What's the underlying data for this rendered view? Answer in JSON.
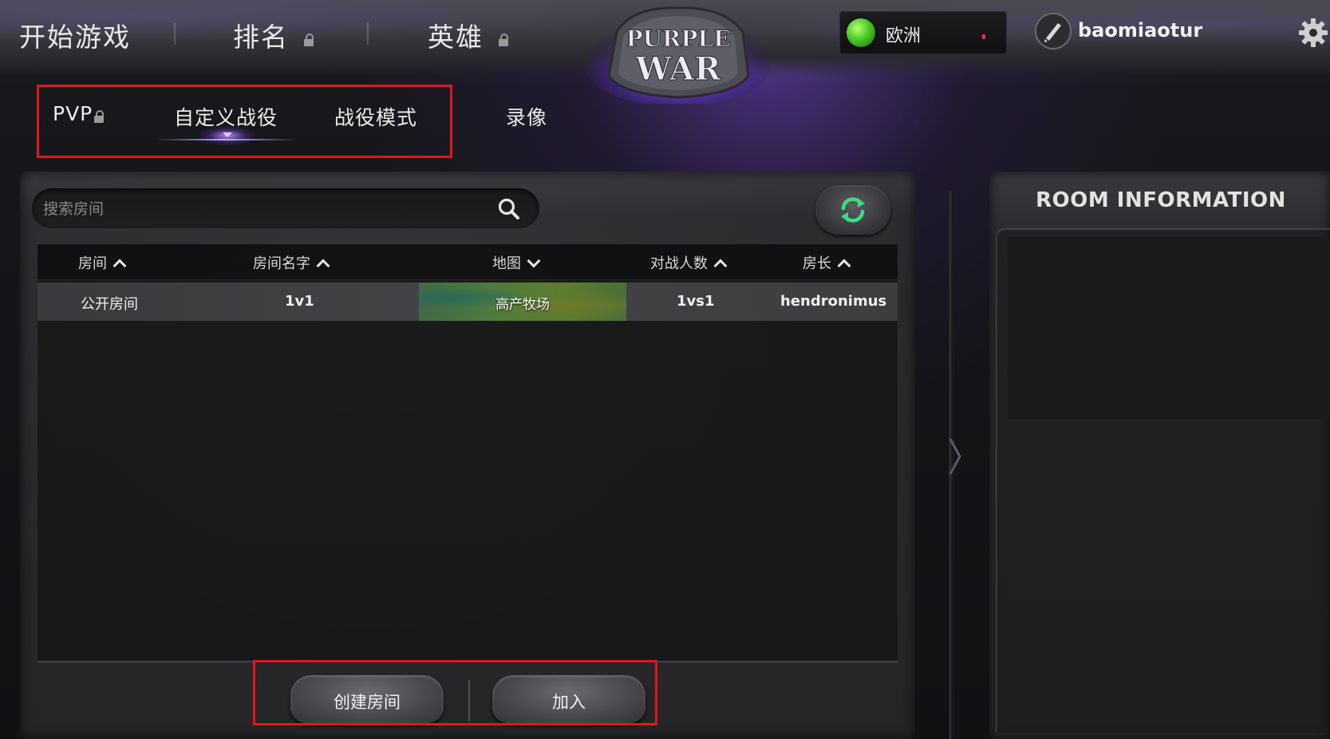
{
  "header": {
    "nav": [
      {
        "label": "开始游戏",
        "locked": false
      },
      {
        "label": "排名",
        "locked": true
      },
      {
        "label": "英雄",
        "locked": true
      }
    ],
    "logo": {
      "line1": "PURPLE",
      "line2": "WAR"
    },
    "region": {
      "label": "欧洲",
      "status_color": "#4fd22c"
    },
    "user": {
      "name": "baomiaotur"
    }
  },
  "subtabs": [
    {
      "label": "PVP",
      "locked": true,
      "active": false
    },
    {
      "label": "自定义战役",
      "locked": false,
      "active": true
    },
    {
      "label": "战役模式",
      "locked": false,
      "active": false
    },
    {
      "label": "录像",
      "locked": false,
      "active": false
    }
  ],
  "search": {
    "placeholder": "搜索房间",
    "value": ""
  },
  "table": {
    "columns": [
      {
        "label": "房间",
        "sort": "asc"
      },
      {
        "label": "房间名字",
        "sort": "asc"
      },
      {
        "label": "地图",
        "sort": "desc"
      },
      {
        "label": "对战人数",
        "sort": "asc"
      },
      {
        "label": "房长",
        "sort": "asc"
      }
    ],
    "rows": [
      {
        "room": "公开房间",
        "name": "1v1",
        "map": "高产牧场",
        "players": "1vs1",
        "host": "hendronimus"
      }
    ]
  },
  "actions": {
    "create_label": "创建房间",
    "join_label": "加入"
  },
  "room_info": {
    "title": "ROOM INFORMATION"
  },
  "colors": {
    "accent_purple": "#7c4dff",
    "highlight_red": "#e2161c",
    "refresh_green": "#3ddc84"
  },
  "icons": [
    "lock-icon",
    "search-icon",
    "refresh-icon",
    "gear-icon",
    "sort-icon",
    "avatar-icon"
  ]
}
